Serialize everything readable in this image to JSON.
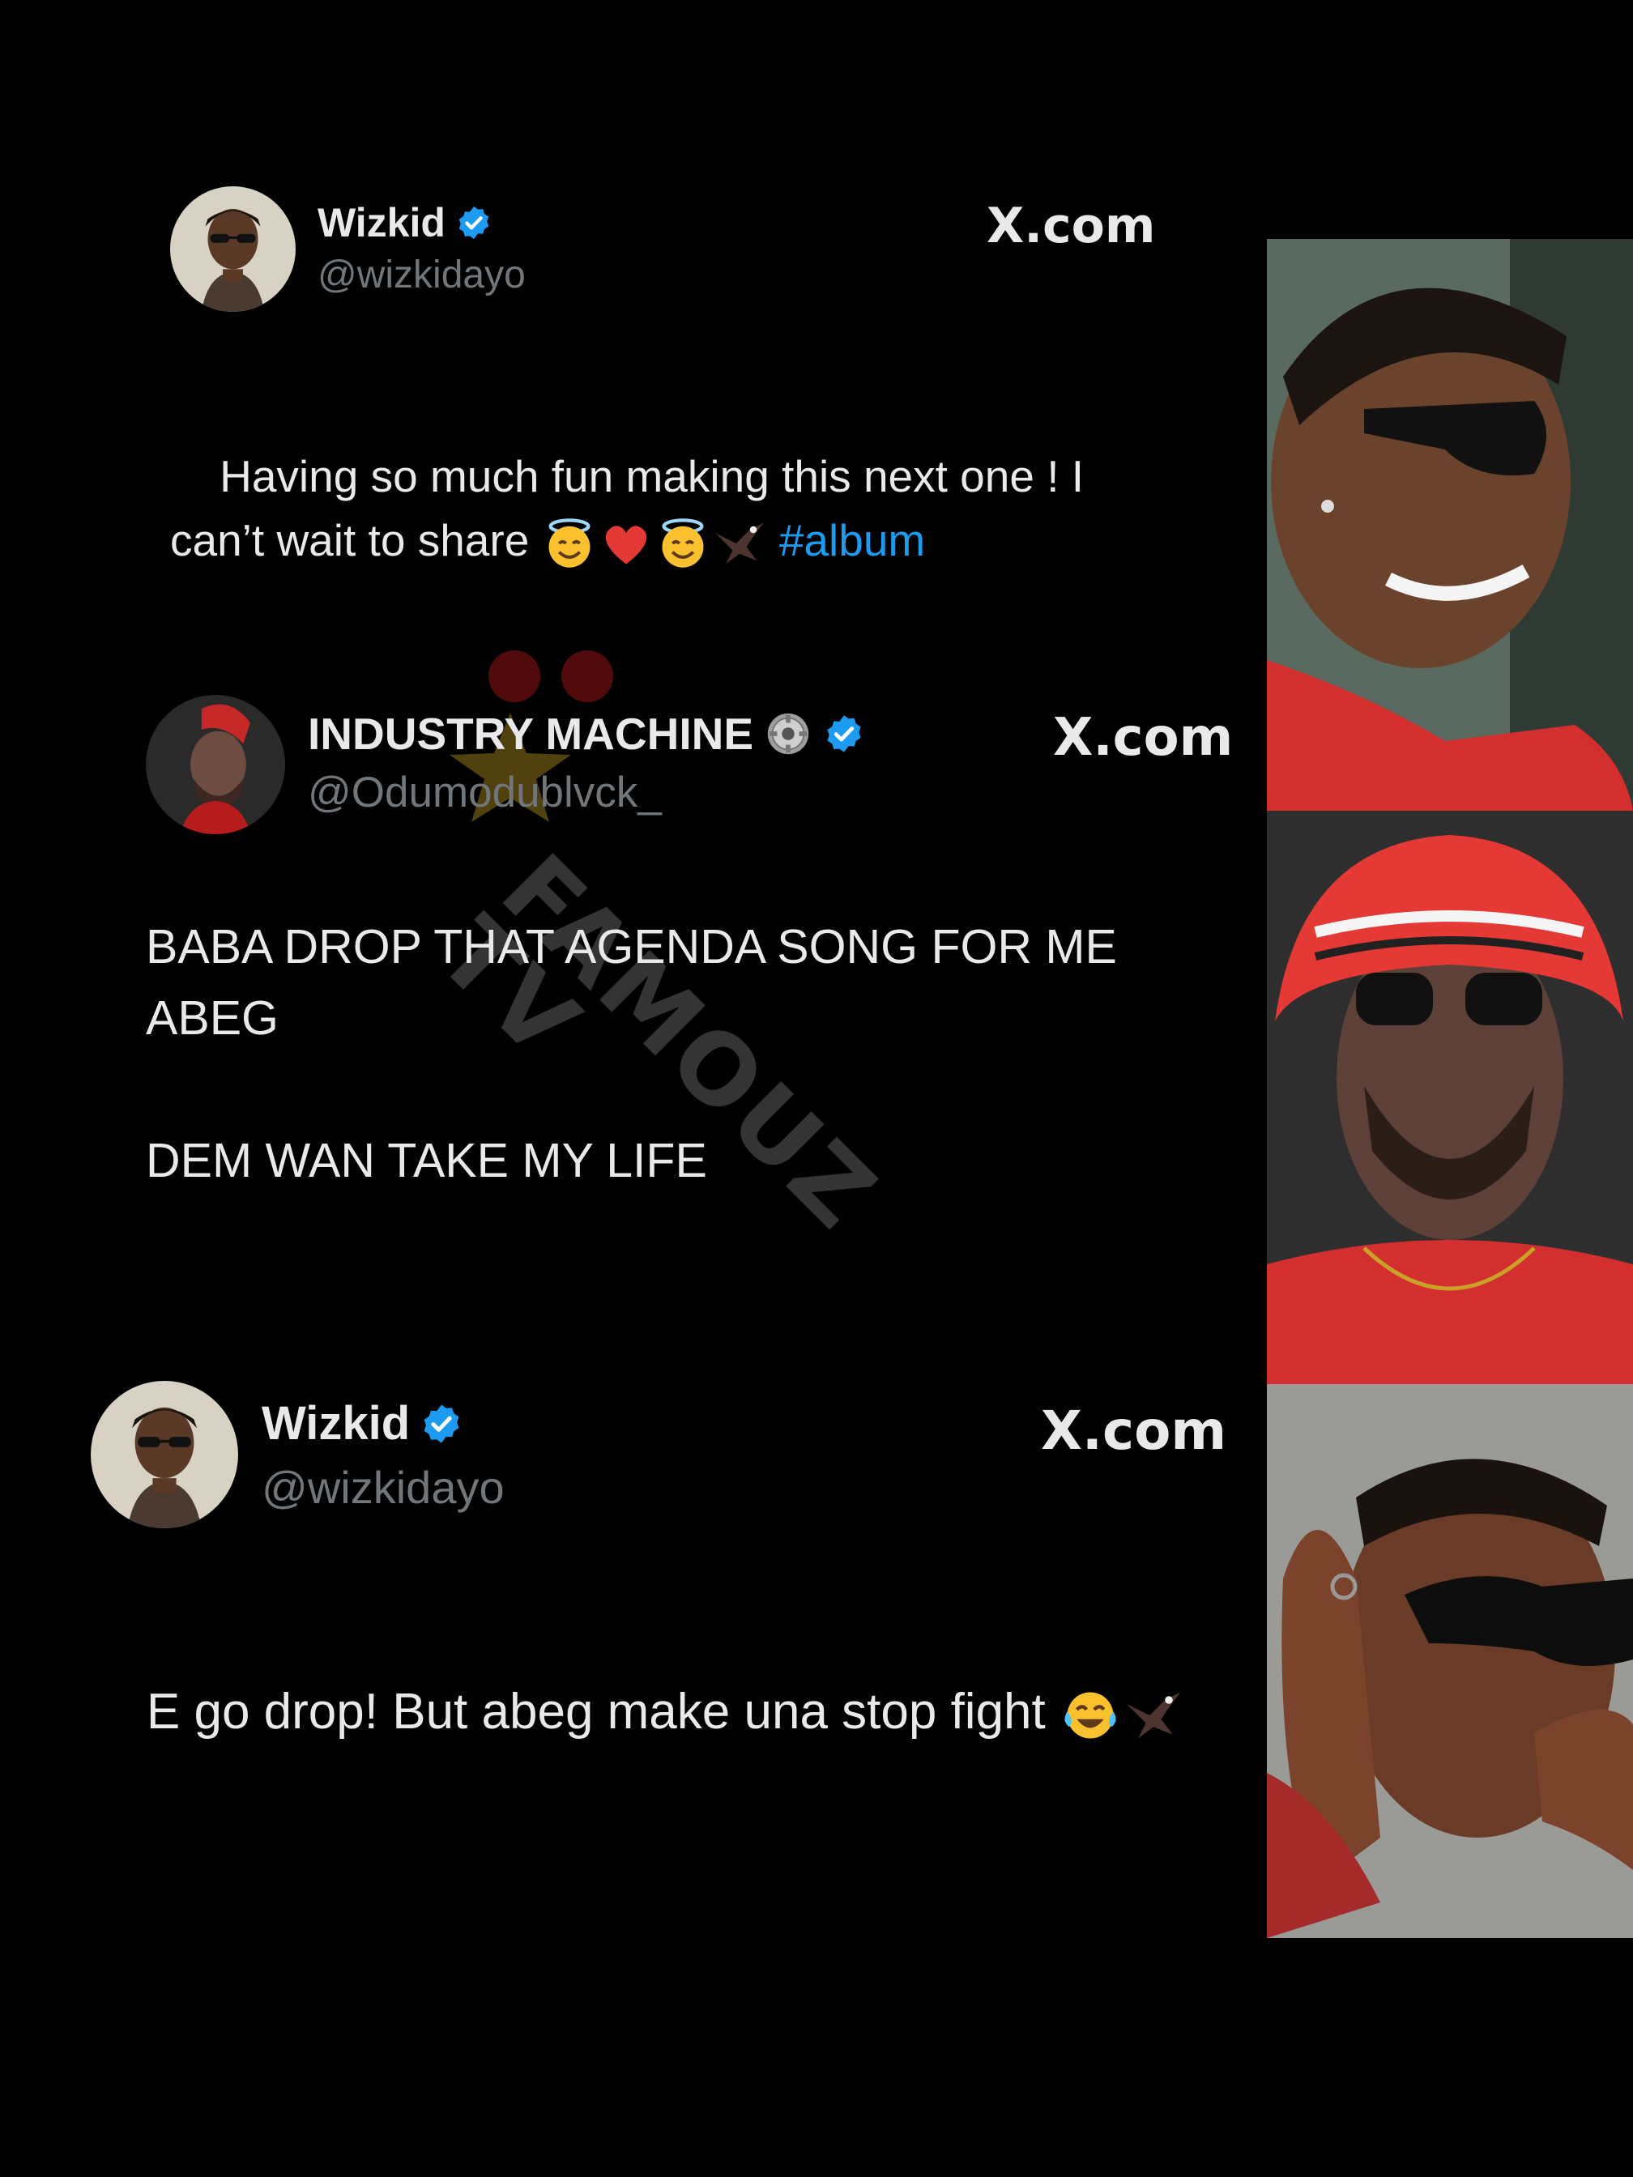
{
  "tweets": [
    {
      "display_name": "Wizkid",
      "handle": "@wizkidayo",
      "brand": "X.com",
      "text": "Having so much fun making this next one ! I\ncan’t wait to share ",
      "hashtag": "#album",
      "emoji": [
        "smiling-face-with-halo",
        "red-heart",
        "smiling-face-with-halo",
        "eagle"
      ]
    },
    {
      "display_name": "INDUSTRY MACHINE",
      "handle": "@Odumodublvck_",
      "brand": "X.com",
      "text": "BABA DROP THAT AGENDA SONG FOR ME\nABEG\n\nDEM WAN TAKE MY LIFE",
      "emoji": [
        "gear"
      ]
    },
    {
      "display_name": "Wizkid",
      "handle": "@wizkidayo",
      "brand": "X.com",
      "text": "E go drop! But abeg make una stop fight ",
      "emoji": [
        "face-with-tears-of-joy",
        "eagle"
      ]
    }
  ],
  "watermark": {
    "text": "FAMOUZ\nTV"
  },
  "colors": {
    "background": "#000000",
    "text": "#e7e9ea",
    "handle": "#71767b",
    "verified": "#1d9bf0",
    "hashtag": "#1d9bf0"
  }
}
